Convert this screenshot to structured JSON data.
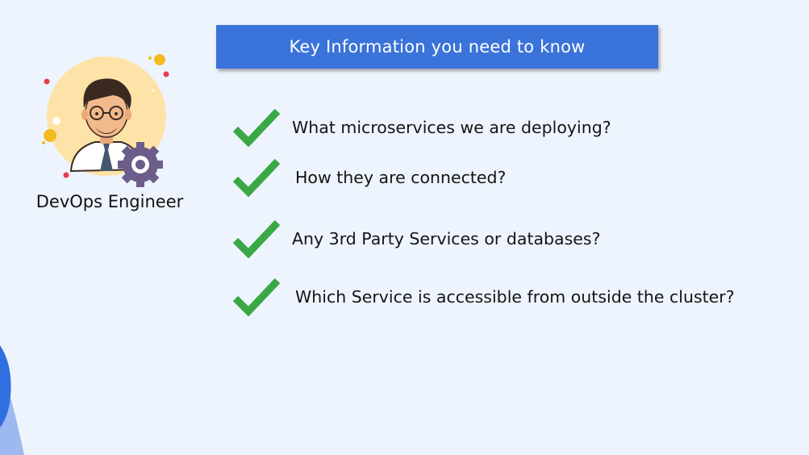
{
  "header": {
    "title": "Key Information you need to know"
  },
  "persona": {
    "caption": "DevOps Engineer",
    "avatar_icon": "devops-engineer-avatar-icon"
  },
  "checklist": {
    "icon": "checkmark-icon",
    "check_color": "#3aa845",
    "items": [
      {
        "label": "What microservices we are deploying?"
      },
      {
        "label": "How they are connected?"
      },
      {
        "label": "Any 3rd Party Services or databases?"
      },
      {
        "label": "Which Service is accessible from outside the cluster?"
      }
    ]
  },
  "colors": {
    "background": "#eef4fd",
    "header_bar": "#3a73d9",
    "accent_blue": "#2f6fe0"
  }
}
